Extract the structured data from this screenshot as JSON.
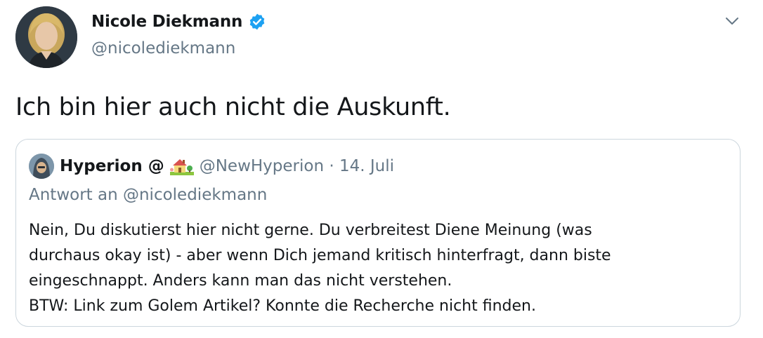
{
  "author": {
    "name": "Nicole Diekmann",
    "handle": "@nicolediekmann",
    "verified_color": "#1da1f2",
    "avatar_icon": "avatar-portrait-icon"
  },
  "tweet": {
    "text": "Ich bin hier auch nicht die Auskunft."
  },
  "menu": {
    "icon": "chevron-down-icon"
  },
  "quote": {
    "name": "Hyperion @",
    "emoji_icon": "house-with-garden-icon",
    "handle_date": "@NewHyperion · 14. Juli",
    "reply_to": "Antwort an @nicolediekmann",
    "lines": [
      "Nein, Du diskutierst hier nicht gerne. Du verbreitest Diene Meinung (was",
      "durchaus okay ist) - aber wenn Dich jemand kritisch hinterfragt, dann biste",
      "eingeschnappt. Anders kann man das nicht verstehen.",
      "BTW: Link zum Golem Artikel? Konnte die Recherche nicht finden."
    ]
  },
  "colors": {
    "text_primary": "#14171a",
    "text_secondary": "#657786",
    "border": "#ccd6dd",
    "accent": "#1da1f2"
  }
}
